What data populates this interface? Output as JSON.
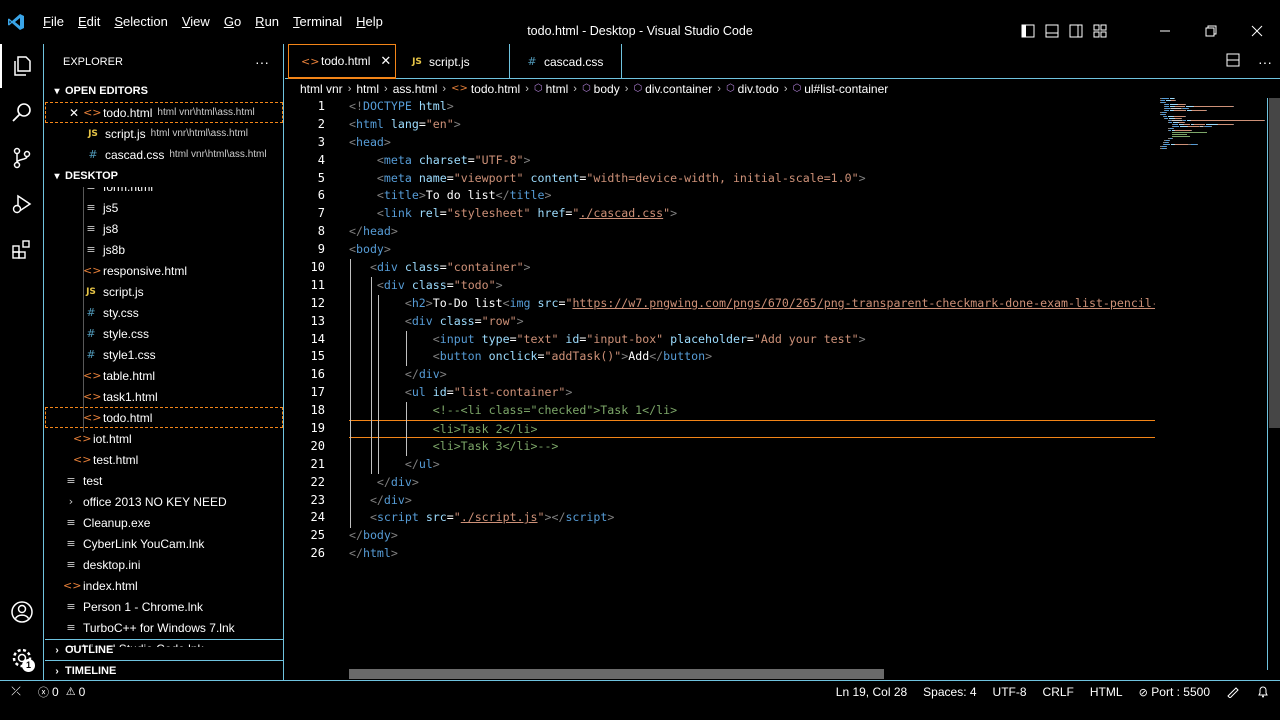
{
  "window": {
    "title": "todo.html - Desktop - Visual Studio Code",
    "menu": [
      {
        "label": "File",
        "key": "F",
        "rest": "ile"
      },
      {
        "label": "Edit",
        "key": "E",
        "rest": "dit"
      },
      {
        "label": "Selection",
        "key": "S",
        "rest": "election"
      },
      {
        "label": "View",
        "key": "V",
        "rest": "iew"
      },
      {
        "label": "Go",
        "key": "G",
        "rest": "o"
      },
      {
        "label": "Run",
        "key": "R",
        "rest": "un"
      },
      {
        "label": "Terminal",
        "key": "T",
        "rest": "erminal"
      },
      {
        "label": "Help",
        "key": "H",
        "rest": "elp"
      }
    ]
  },
  "activity_bar": {
    "items": [
      "files-icon",
      "search-icon",
      "source-control-icon",
      "run-debug-icon",
      "extensions-icon"
    ],
    "bottom": [
      "account-icon",
      "manage-gear-icon"
    ],
    "manage_badge": "1"
  },
  "sidebar": {
    "title": "EXPLORER",
    "more": "···",
    "open_editors": {
      "label": "OPEN EDITORS",
      "items": [
        {
          "name": "todo.html",
          "path": "html vnr\\html\\ass.html",
          "type": "html",
          "close": "✕"
        },
        {
          "name": "script.js",
          "path": "html vnr\\html\\ass.html",
          "type": "js"
        },
        {
          "name": "cascad.css",
          "path": "html vnr\\html\\ass.html",
          "type": "css"
        }
      ]
    },
    "desktop": {
      "label": "DESKTOP",
      "items": [
        {
          "name": "form.html",
          "type": "text",
          "level": 2
        },
        {
          "name": "js5",
          "type": "text",
          "level": 2
        },
        {
          "name": "js8",
          "type": "text",
          "level": 2
        },
        {
          "name": "js8b",
          "type": "text",
          "level": 2
        },
        {
          "name": "responsive.html",
          "type": "html",
          "level": 2
        },
        {
          "name": "script.js",
          "type": "js",
          "level": 2
        },
        {
          "name": "sty.css",
          "type": "css",
          "level": 2
        },
        {
          "name": "style.css",
          "type": "css",
          "level": 2
        },
        {
          "name": "style1.css",
          "type": "css",
          "level": 2
        },
        {
          "name": "table.html",
          "type": "html",
          "level": 2
        },
        {
          "name": "task1.html",
          "type": "html",
          "level": 2
        },
        {
          "name": "todo.html",
          "type": "html",
          "level": 2,
          "selected": true
        },
        {
          "name": "iot.html",
          "type": "html",
          "level": 1
        },
        {
          "name": "test.html",
          "type": "html",
          "level": 1
        },
        {
          "name": "test",
          "type": "text",
          "level": 0
        },
        {
          "name": "office 2013 NO KEY NEED",
          "type": "folder",
          "level": 0
        },
        {
          "name": "Cleanup.exe",
          "type": "text",
          "level": 0
        },
        {
          "name": "CyberLink YouCam.lnk",
          "type": "text",
          "level": 0
        },
        {
          "name": "desktop.ini",
          "type": "text",
          "level": 0
        },
        {
          "name": "index.html",
          "type": "html",
          "level": 0
        },
        {
          "name": "Person 1 - Chrome.lnk",
          "type": "text",
          "level": 0
        },
        {
          "name": "TurboC++ for Windows 7.lnk",
          "type": "text",
          "level": 0
        },
        {
          "name": "Visual Studio Code.lnk",
          "type": "text",
          "level": 0
        }
      ]
    },
    "outline": "OUTLINE",
    "timeline": "TIMELINE"
  },
  "tabs": [
    {
      "label": "todo.html",
      "type": "html",
      "active": true,
      "close": "✕"
    },
    {
      "label": "script.js",
      "type": "js",
      "active": false
    },
    {
      "label": "cascad.css",
      "type": "css",
      "active": false
    }
  ],
  "breadcrumbs": [
    "html vnr",
    "html",
    "ass.html",
    "todo.html",
    "html",
    "body",
    "div.container",
    "div.todo",
    "ul#list-container"
  ],
  "editor": {
    "current_line": 19,
    "lines": [
      [
        [
          "p",
          "<!"
        ],
        [
          "t",
          "DOCTYPE"
        ],
        [
          "x",
          " "
        ],
        [
          "a",
          "html"
        ],
        [
          "p",
          ">"
        ]
      ],
      [
        [
          "p",
          "<"
        ],
        [
          "t",
          "html"
        ],
        [
          "x",
          " "
        ],
        [
          "a",
          "lang"
        ],
        [
          "x",
          "="
        ],
        [
          "s",
          "\"en\""
        ],
        [
          "p",
          ">"
        ]
      ],
      [
        [
          "p",
          "<"
        ],
        [
          "t",
          "head"
        ],
        [
          "p",
          ">"
        ]
      ],
      [
        [
          "x",
          "    "
        ],
        [
          "p",
          "<"
        ],
        [
          "t",
          "meta"
        ],
        [
          "x",
          " "
        ],
        [
          "a",
          "charset"
        ],
        [
          "x",
          "="
        ],
        [
          "s",
          "\"UTF-8\""
        ],
        [
          "p",
          ">"
        ]
      ],
      [
        [
          "x",
          "    "
        ],
        [
          "p",
          "<"
        ],
        [
          "t",
          "meta"
        ],
        [
          "x",
          " "
        ],
        [
          "a",
          "name"
        ],
        [
          "x",
          "="
        ],
        [
          "s",
          "\"viewport\""
        ],
        [
          "x",
          " "
        ],
        [
          "a",
          "content"
        ],
        [
          "x",
          "="
        ],
        [
          "s",
          "\"width=device-width, initial-scale=1.0\""
        ],
        [
          "p",
          ">"
        ]
      ],
      [
        [
          "x",
          "    "
        ],
        [
          "p",
          "<"
        ],
        [
          "t",
          "title"
        ],
        [
          "p",
          ">"
        ],
        [
          "x",
          "To do list"
        ],
        [
          "p",
          "</"
        ],
        [
          "t",
          "title"
        ],
        [
          "p",
          ">"
        ]
      ],
      [
        [
          "x",
          "    "
        ],
        [
          "p",
          "<"
        ],
        [
          "t",
          "link"
        ],
        [
          "x",
          " "
        ],
        [
          "a",
          "rel"
        ],
        [
          "x",
          "="
        ],
        [
          "s",
          "\"stylesheet\""
        ],
        [
          "x",
          " "
        ],
        [
          "a",
          "href"
        ],
        [
          "x",
          "="
        ],
        [
          "s",
          "\""
        ],
        [
          "u",
          "./cascad.css"
        ],
        [
          "s",
          "\""
        ],
        [
          "p",
          ">"
        ]
      ],
      [
        [
          "p",
          "</"
        ],
        [
          "t",
          "head"
        ],
        [
          "p",
          ">"
        ]
      ],
      [
        [
          "p",
          "<"
        ],
        [
          "t",
          "body"
        ],
        [
          "p",
          ">"
        ]
      ],
      [
        [
          "x",
          "   "
        ],
        [
          "p",
          "<"
        ],
        [
          "t",
          "div"
        ],
        [
          "x",
          " "
        ],
        [
          "a",
          "class"
        ],
        [
          "x",
          "="
        ],
        [
          "s",
          "\"container\""
        ],
        [
          "p",
          ">"
        ]
      ],
      [
        [
          "x",
          "    "
        ],
        [
          "p",
          "<"
        ],
        [
          "t",
          "div"
        ],
        [
          "x",
          " "
        ],
        [
          "a",
          "class"
        ],
        [
          "x",
          "="
        ],
        [
          "s",
          "\"todo\""
        ],
        [
          "p",
          ">"
        ]
      ],
      [
        [
          "x",
          "        "
        ],
        [
          "p",
          "<"
        ],
        [
          "t",
          "h2"
        ],
        [
          "p",
          ">"
        ],
        [
          "x",
          "To-Do list"
        ],
        [
          "p",
          "<"
        ],
        [
          "t",
          "img"
        ],
        [
          "x",
          " "
        ],
        [
          "a",
          "src"
        ],
        [
          "x",
          "="
        ],
        [
          "s",
          "\""
        ],
        [
          "u",
          "https://w7.pngwing.com/pngs/670/265/png-transparent-checkmark-done-exam-list-pencil-todo-xomo-basics-icon"
        ],
        [
          "s",
          "\""
        ],
        [
          "p",
          ">"
        ]
      ],
      [
        [
          "x",
          "        "
        ],
        [
          "p",
          "<"
        ],
        [
          "t",
          "div"
        ],
        [
          "x",
          " "
        ],
        [
          "a",
          "class"
        ],
        [
          "x",
          "="
        ],
        [
          "s",
          "\"row\""
        ],
        [
          "p",
          ">"
        ]
      ],
      [
        [
          "x",
          "            "
        ],
        [
          "p",
          "<"
        ],
        [
          "t",
          "input"
        ],
        [
          "x",
          " "
        ],
        [
          "a",
          "type"
        ],
        [
          "x",
          "="
        ],
        [
          "s",
          "\"text\""
        ],
        [
          "x",
          " "
        ],
        [
          "a",
          "id"
        ],
        [
          "x",
          "="
        ],
        [
          "s",
          "\"input-box\""
        ],
        [
          "x",
          " "
        ],
        [
          "a",
          "placeholder"
        ],
        [
          "x",
          "="
        ],
        [
          "s",
          "\"Add your test\""
        ],
        [
          "p",
          ">"
        ]
      ],
      [
        [
          "x",
          "            "
        ],
        [
          "p",
          "<"
        ],
        [
          "t",
          "button"
        ],
        [
          "x",
          " "
        ],
        [
          "a",
          "onclick"
        ],
        [
          "x",
          "="
        ],
        [
          "s",
          "\"addTask()\""
        ],
        [
          "p",
          ">"
        ],
        [
          "x",
          "Add"
        ],
        [
          "p",
          "</"
        ],
        [
          "t",
          "button"
        ],
        [
          "p",
          ">"
        ]
      ],
      [
        [
          "x",
          "        "
        ],
        [
          "p",
          "</"
        ],
        [
          "t",
          "div"
        ],
        [
          "p",
          ">"
        ]
      ],
      [
        [
          "x",
          "        "
        ],
        [
          "p",
          "<"
        ],
        [
          "t",
          "ul"
        ],
        [
          "x",
          " "
        ],
        [
          "a",
          "id"
        ],
        [
          "x",
          "="
        ],
        [
          "s",
          "\"list-container\""
        ],
        [
          "p",
          ">"
        ]
      ],
      [
        [
          "x",
          "            "
        ],
        [
          "c",
          "<!--<li class=\"checked\">Task 1</li>"
        ]
      ],
      [
        [
          "x",
          "            "
        ],
        [
          "c",
          "<li>Task 2</li>"
        ]
      ],
      [
        [
          "x",
          "            "
        ],
        [
          "c",
          "<li>Task 3</li>-->"
        ]
      ],
      [
        [
          "x",
          "        "
        ],
        [
          "p",
          "</"
        ],
        [
          "t",
          "ul"
        ],
        [
          "p",
          ">"
        ]
      ],
      [
        [
          "x",
          "    "
        ],
        [
          "p",
          "</"
        ],
        [
          "t",
          "div"
        ],
        [
          "p",
          ">"
        ]
      ],
      [
        [
          "x",
          "   "
        ],
        [
          "p",
          "</"
        ],
        [
          "t",
          "div"
        ],
        [
          "p",
          ">"
        ]
      ],
      [
        [
          "x",
          "   "
        ],
        [
          "p",
          "<"
        ],
        [
          "t",
          "script"
        ],
        [
          "x",
          " "
        ],
        [
          "a",
          "src"
        ],
        [
          "x",
          "="
        ],
        [
          "s",
          "\""
        ],
        [
          "u",
          "./script.js"
        ],
        [
          "s",
          "\""
        ],
        [
          "p",
          "></"
        ],
        [
          "t",
          "script"
        ],
        [
          "p",
          ">"
        ]
      ],
      [
        [
          "p",
          "</"
        ],
        [
          "t",
          "body"
        ],
        [
          "p",
          ">"
        ]
      ],
      [
        [
          "p",
          "</"
        ],
        [
          "t",
          "html"
        ],
        [
          "p",
          ">"
        ]
      ]
    ]
  },
  "status": {
    "remote_icon": "⤫",
    "errors": "0",
    "warnings": "0",
    "position": "Ln 19, Col 28",
    "spaces": "Spaces: 4",
    "encoding": "UTF-8",
    "eol": "CRLF",
    "language": "HTML",
    "port": "Port : 5500"
  },
  "colors": {
    "border": "#6fc3df",
    "focus": "#f38518",
    "tag": "#569cd6",
    "attr": "#9cdcfe",
    "string": "#ce9178",
    "comment": "#7ca668"
  }
}
